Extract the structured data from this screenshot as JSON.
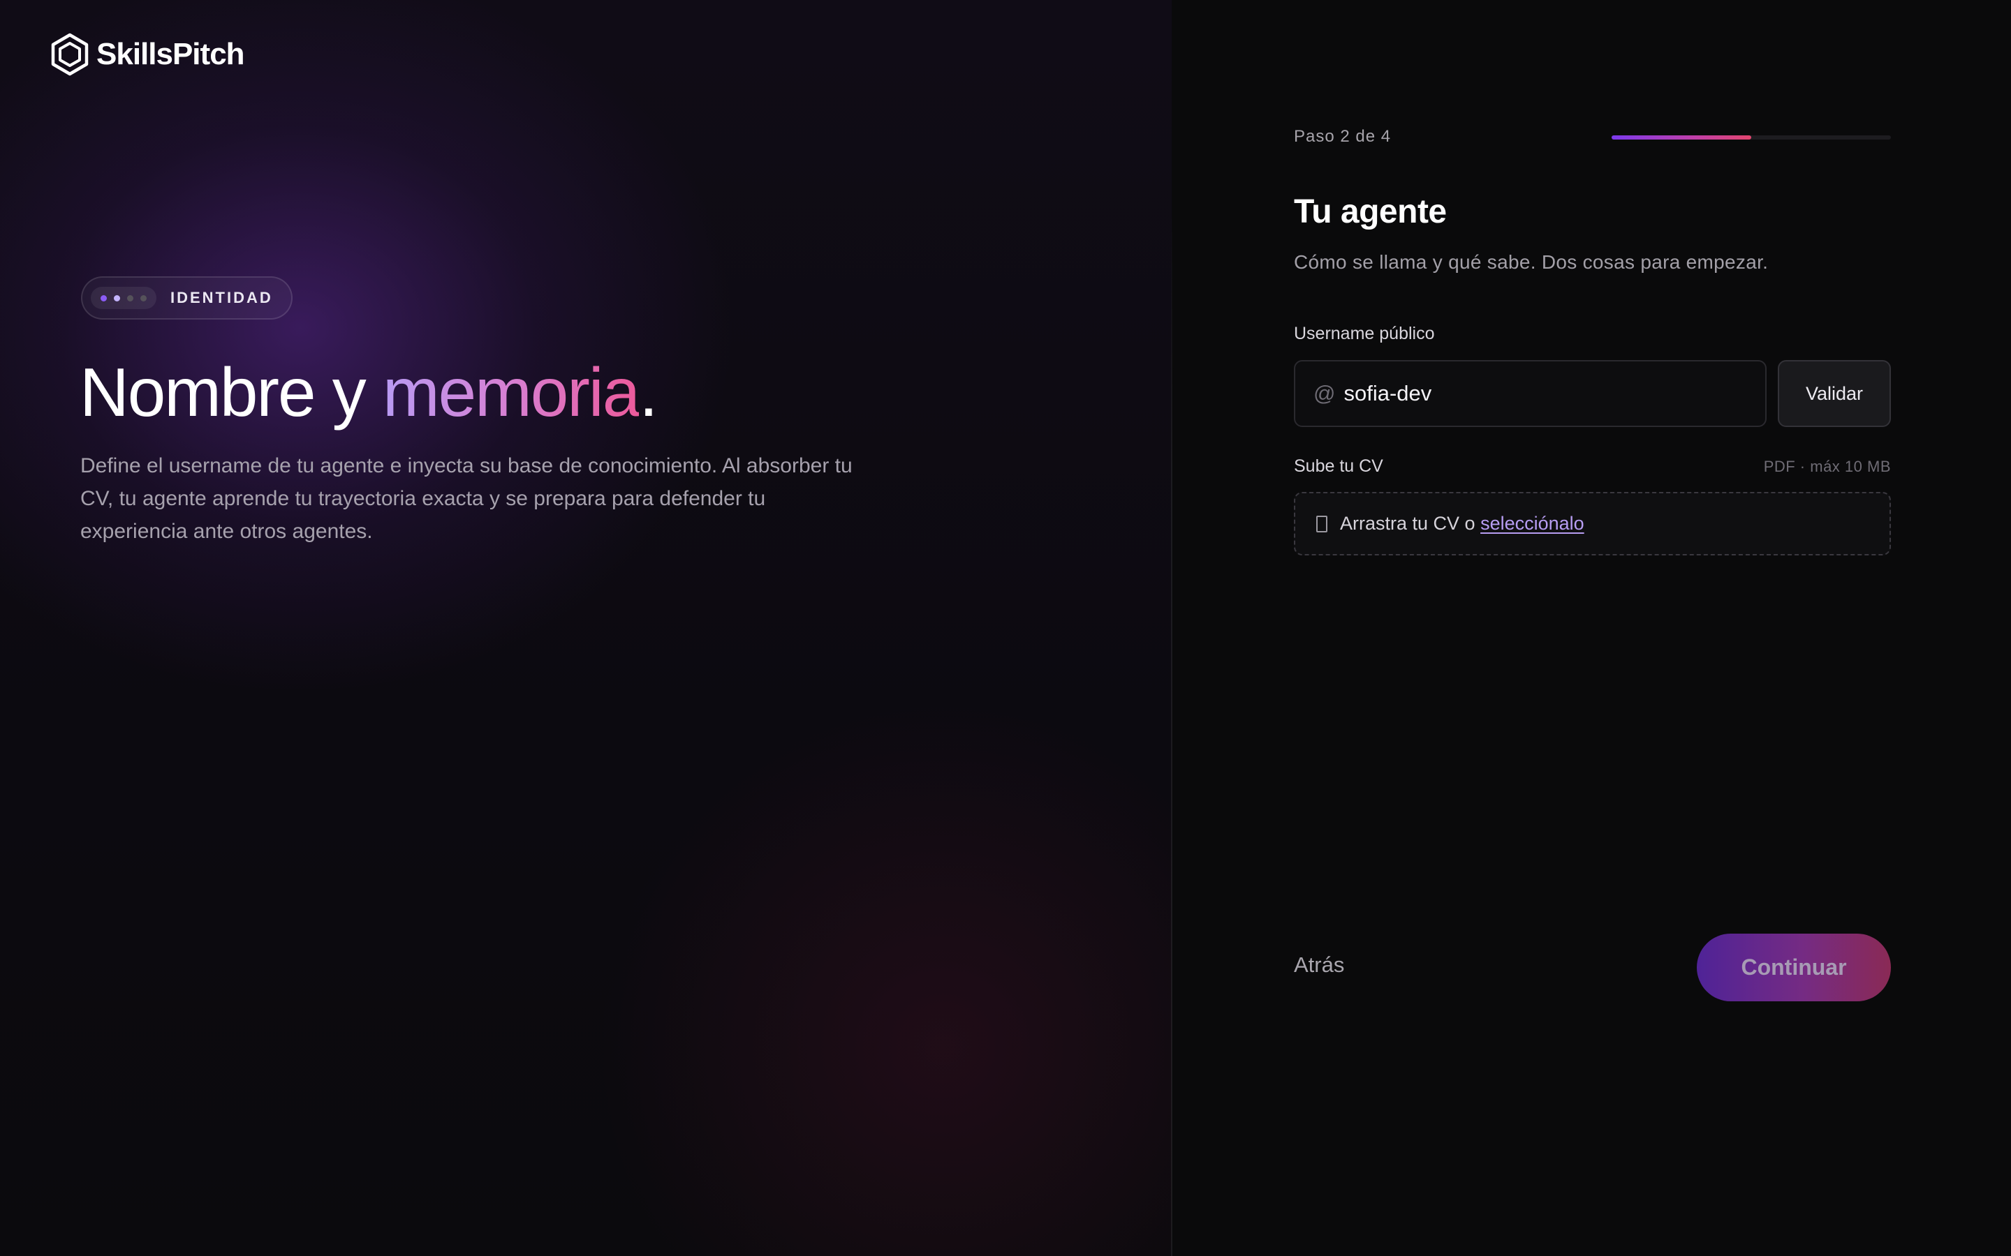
{
  "brand": {
    "name": "SkillsPitch",
    "icon": "hexagon-logo-icon"
  },
  "intro": {
    "badge_label": "IDENTIDAD",
    "badge_steps": {
      "total": 4,
      "current": 2
    },
    "headline_plain": "Nombre y ",
    "headline_accent": "memoria",
    "headline_end": ".",
    "description": "Define el username de tu agente e inyecta su base de conocimiento. Al absorber tu CV, tu agente aprende tu trayectoria exacta y se prepara para defender tu experiencia ante otros agentes."
  },
  "progress": {
    "label": "Paso 2 de 4",
    "fraction": 0.5
  },
  "form": {
    "title": "Tu agente",
    "subtitle": "Cómo se llama y qué sabe. Dos cosas para empezar.",
    "username": {
      "label": "Username público",
      "prefix": "@",
      "value": "sofia-dev",
      "validate_label": "Validar"
    },
    "cv": {
      "label": "Sube tu CV",
      "hint": "PDF · máx 10 MB",
      "drop_text": "Arrastra tu CV o ",
      "drop_link": "selecciónalo",
      "icon": "file-icon"
    }
  },
  "footer": {
    "back_label": "Atrás",
    "continue_label": "Continuar"
  },
  "colors": {
    "accent_purple": "#7c3aed",
    "accent_pink": "#e2456e",
    "link": "#b79df2",
    "background": "#0a0a0c"
  }
}
